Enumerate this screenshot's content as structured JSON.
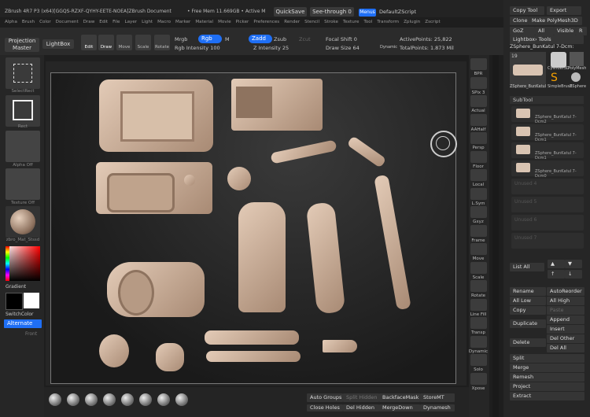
{
  "title_bar": {
    "app": "ZBrush 4R7 P3 (x64)[GGQS-RZXF-QYHY-EETE-NOEA]ZBrush Document",
    "mem": "• Free Mem 11.669GB • Active M",
    "quicksave": "QuickSave",
    "seethrough": "See-through  0",
    "menus": "Menus",
    "defaultscript": "DefaultZScript"
  },
  "menu_items": [
    "Alpha",
    "Brush",
    "Color",
    "Document",
    "Draw",
    "Edit",
    "File",
    "Layer",
    "Light",
    "Macro",
    "Marker",
    "Material",
    "Movie",
    "Picker",
    "Preferences",
    "Render",
    "Stencil",
    "Stroke",
    "Texture",
    "Tool",
    "Transform",
    "Zplugin",
    "Zscript"
  ],
  "toolbar": {
    "projection_master": "Projection Master",
    "lightbox": "LightBox",
    "edit": "Edit",
    "draw": "Draw",
    "move": "Move",
    "scale": "Scale",
    "rotate": "Rotate",
    "mrgb": "Mrgb",
    "rgb": "Rgb",
    "m": "M",
    "zadd": "Zadd",
    "zsub": "Zsub",
    "zcut": "Zcut",
    "rgb_intensity": "Rgb Intensity 100",
    "z_intensity": "Z Intensity 25",
    "focal_shift": "Focal Shift 0",
    "draw_size": "Draw Size 64",
    "dynamic": "Dynamic",
    "active_points": "ActivePoints: 25,822",
    "total_points": "TotalPoints: 1.873 Mil"
  },
  "left_shelf": {
    "standard": "SelectRect",
    "rect": "Rect",
    "alpha_off": "Alpha Off",
    "texture_off": "Texture Off",
    "material": "zbro_Mat_Stssd",
    "gradient": "Gradient",
    "switchcolor": "SwitchColor",
    "alternate": "Alternate",
    "front": "Front"
  },
  "right_shelf": [
    "BPR",
    "SPix 3",
    "Actual",
    "AAHalf",
    "Persp",
    "Floor",
    "Local",
    "L.Sym",
    "Gxyz",
    "Frame",
    "Move",
    "Scale",
    "Rotate",
    "Line Fill",
    "Transp",
    "Dynamic",
    "Solo",
    "Xpose"
  ],
  "tool_palette": {
    "copy_tool": "Copy Tool",
    "export": "Export",
    "clone": "Clone",
    "make_polymesh": "Make PolyMesh3D",
    "goz": "GoZ",
    "all": "All",
    "visible": "Visible",
    "r": "R",
    "lightbox_tools": "Lightbox› Tools",
    "current_tool": "ZSphere_BunKatul 7-Dcm:",
    "count": "19",
    "thumb1": "ZSphere_BunKatul",
    "thumb2": "Cylinder3D",
    "thumb3": "PolyMesh",
    "thumb4": "SimpleBrush",
    "thumb5": "ZSphere",
    "subtool_title": "SubTool",
    "subtools": [
      "ZSphere_BunKatul 7-Dcm2",
      "ZSphere_BunKatul 7-Dcm1",
      "ZSphere_BunKatul 7-Dcm1",
      "ZSphere_BunKatul 7-Dcm0",
      "Unused 4",
      "Unused 5",
      "Unused 6",
      "Unused 7"
    ],
    "list_all": "List All",
    "rename": "Rename",
    "autoreorder": "AutoReorder",
    "all_low": "All Low",
    "all_high": "All High",
    "copy": "Copy",
    "paste": "Paste",
    "duplicate": "Duplicate",
    "append": "Append",
    "insert": "Insert",
    "delete": "Delete",
    "del_other": "Del Other",
    "del_all": "Del All",
    "split": "Split",
    "merge": "Merge",
    "remesh": "Remesh",
    "project": "Project",
    "extract": "Extract"
  },
  "bottom_bar": {
    "auto_groups": "Auto Groups",
    "split_hidden": "Split Hidden",
    "backface_mask": "BackfaceMask",
    "storemt": "StoreMT",
    "close_holes": "Close Holes",
    "del_hidden": "Del Hidden",
    "mergedown": "MergeDown",
    "dynamesh": "Dynamesh"
  },
  "colors": {
    "accent": "#1f6ff5",
    "bg": "#1e1e1e",
    "panel": "#2a2a2a",
    "model": "#c9ad95"
  }
}
